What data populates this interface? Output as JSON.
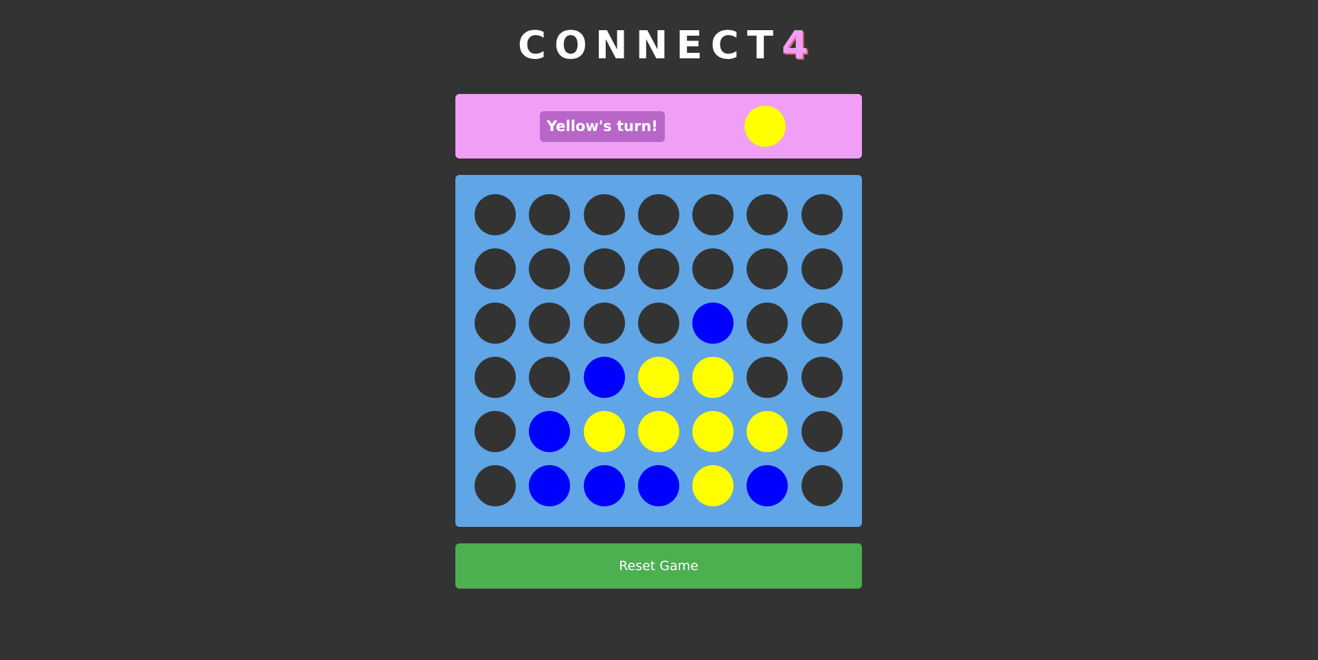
{
  "title": {
    "text": "CONNECT",
    "number": "4"
  },
  "status": {
    "message": "Yellow's turn!",
    "current_player": "yellow"
  },
  "colors": {
    "empty": "#333333",
    "blue": "#0000ff",
    "yellow": "#ffff00",
    "board": "#60a5e5",
    "status_bar": "#f09ef6",
    "turn_label_bg": "#b966c9",
    "reset_button": "#4caf50"
  },
  "board": {
    "rows": [
      [
        "empty",
        "empty",
        "empty",
        "empty",
        "empty",
        "empty",
        "empty"
      ],
      [
        "empty",
        "empty",
        "empty",
        "empty",
        "empty",
        "empty",
        "empty"
      ],
      [
        "empty",
        "empty",
        "empty",
        "empty",
        "blue",
        "empty",
        "empty"
      ],
      [
        "empty",
        "empty",
        "blue",
        "yellow",
        "yellow",
        "empty",
        "empty"
      ],
      [
        "empty",
        "blue",
        "yellow",
        "yellow",
        "yellow",
        "yellow",
        "empty"
      ],
      [
        "empty",
        "blue",
        "blue",
        "blue",
        "yellow",
        "blue",
        "empty"
      ]
    ]
  },
  "controls": {
    "reset_label": "Reset Game"
  }
}
